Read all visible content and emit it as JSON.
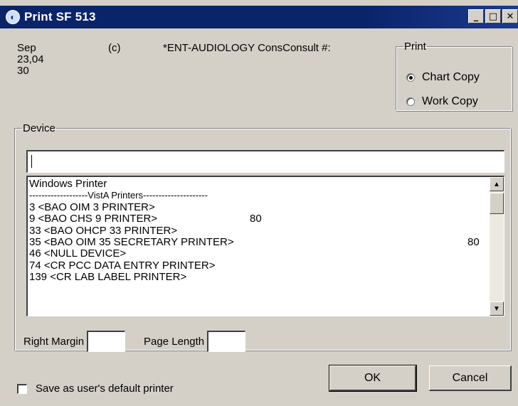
{
  "window": {
    "title": "Print SF 513",
    "buttons": {
      "minimize": "_",
      "maximize": "□",
      "close": "✕"
    }
  },
  "info": {
    "date_line1": "Sep 23,04",
    "date_line2": "30",
    "code": "(c)",
    "text": "*ENT-AUDIOLOGY ConsConsult #:"
  },
  "print_group": {
    "legend": "Print",
    "options": [
      {
        "label": "Chart Copy",
        "selected": true
      },
      {
        "label": "Work Copy",
        "selected": false
      }
    ]
  },
  "device": {
    "legend": "Device",
    "input_value": "",
    "list": [
      {
        "text": "Windows Printer",
        "num": ""
      },
      {
        "text": "-------------------VistA Printers---------------------",
        "num": ""
      },
      {
        "text": "3  <BAO OIM 3 PRINTER>",
        "num": ""
      },
      {
        "text": "9  <BAO CHS 9 PRINTER>",
        "num": "80"
      },
      {
        "text": "33  <BAO OHCP 33 PRINTER>",
        "num": ""
      },
      {
        "text": "35  <BAO OIM 35 SECRETARY PRINTER>",
        "num": "80"
      },
      {
        "text": "46  <NULL DEVICE>",
        "num": ""
      },
      {
        "text": "74  <CR PCC DATA ENTRY PRINTER>",
        "num": ""
      },
      {
        "text": "139  <CR LAB LABEL PRINTER>",
        "num": ""
      }
    ]
  },
  "margins": {
    "right_margin_label": "Right Margin",
    "right_margin_value": "",
    "page_length_label": "Page Length",
    "page_length_value": ""
  },
  "buttons": {
    "ok": "OK",
    "cancel": "Cancel"
  },
  "default_printer": {
    "label": "Save as user's default printer",
    "checked": false
  }
}
